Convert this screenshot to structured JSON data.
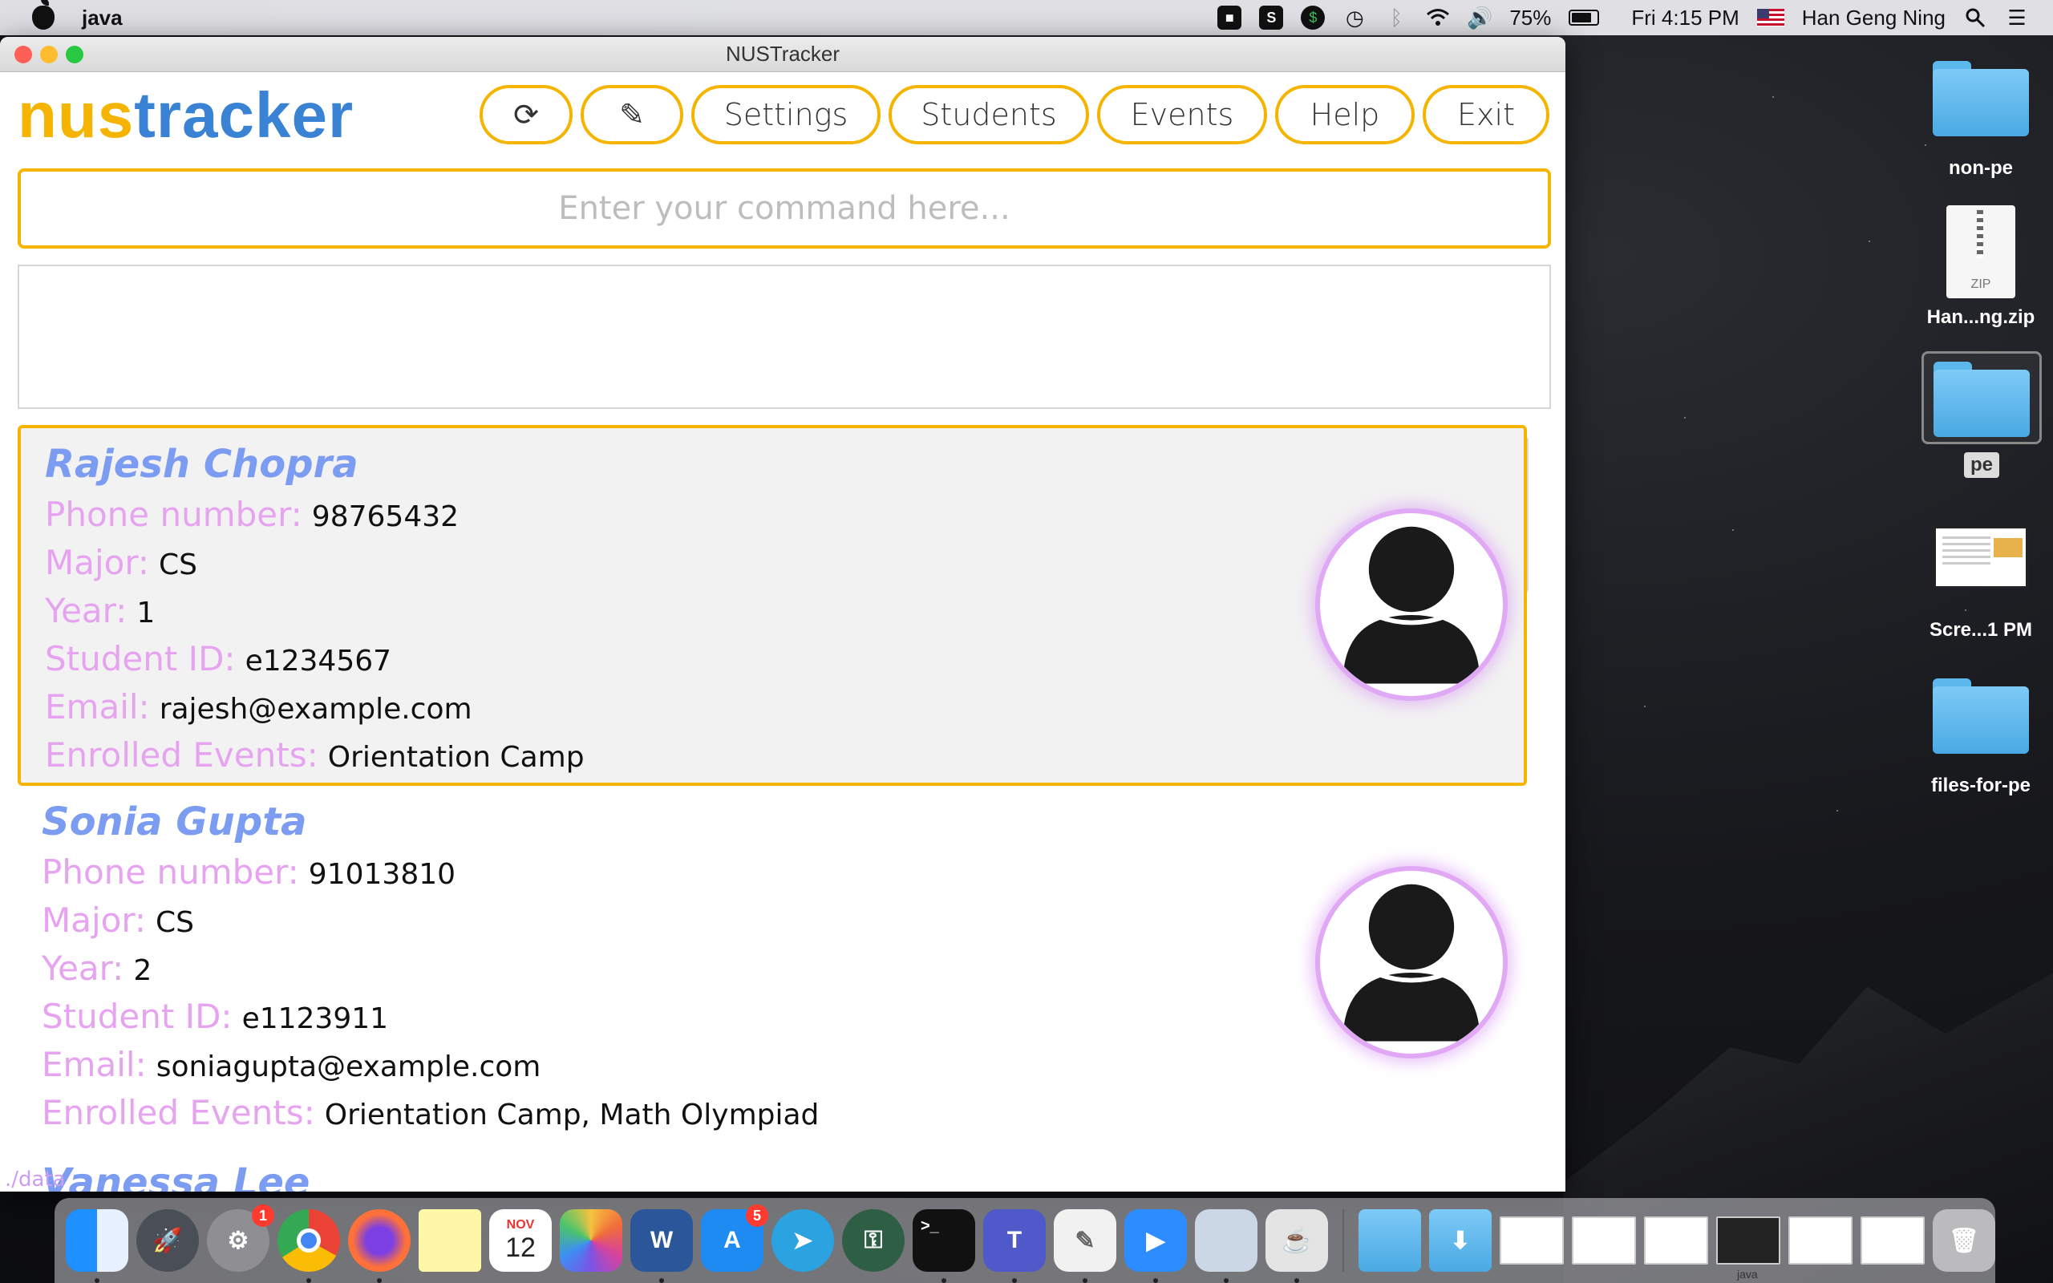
{
  "menubar": {
    "app_name": "java",
    "battery": "75%",
    "clock": "Fri 4:15 PM",
    "user": "Han Geng Ning"
  },
  "window": {
    "title": "NUSTracker"
  },
  "app": {
    "logo_part1": "nus",
    "logo_part2": "tracker",
    "toolbar": {
      "refresh_icon": "⟳",
      "theme_icon": "✎",
      "settings": "Settings",
      "students": "Students",
      "events": "Events",
      "help": "Help",
      "exit": "Exit"
    },
    "command_placeholder": "Enter your command here...",
    "status_path": "./data",
    "labels": {
      "phone": "Phone number:",
      "major": "Major:",
      "year": "Year:",
      "student_id": "Student ID:",
      "email": "Email:",
      "events": "Enrolled Events:"
    },
    "students": [
      {
        "name": "Rajesh Chopra",
        "phone": "98765432",
        "major": "CS",
        "year": "1",
        "student_id": "e1234567",
        "email": "rajesh@example.com",
        "events": "Orientation Camp"
      },
      {
        "name": "Sonia Gupta",
        "phone": "91013810",
        "major": "CS",
        "year": "2",
        "student_id": "e1123911",
        "email": "soniagupta@example.com",
        "events": "Orientation Camp, Math Olympiad"
      },
      {
        "name": "Vanessa Lee"
      }
    ]
  },
  "desktop": [
    {
      "label": "non-pe",
      "kind": "folder"
    },
    {
      "label": "Han...ng.zip",
      "kind": "zip",
      "badge": "ZIP"
    },
    {
      "label": "pe",
      "kind": "folder-selected"
    },
    {
      "label": "Scre...1 PM",
      "kind": "screenshot"
    },
    {
      "label": "files-for-pe",
      "kind": "folder"
    }
  ],
  "dock": {
    "calendar_month": "NOV",
    "calendar_day": "12",
    "settings_badge": "1",
    "appstore_badge": "5",
    "java_label": "java"
  }
}
